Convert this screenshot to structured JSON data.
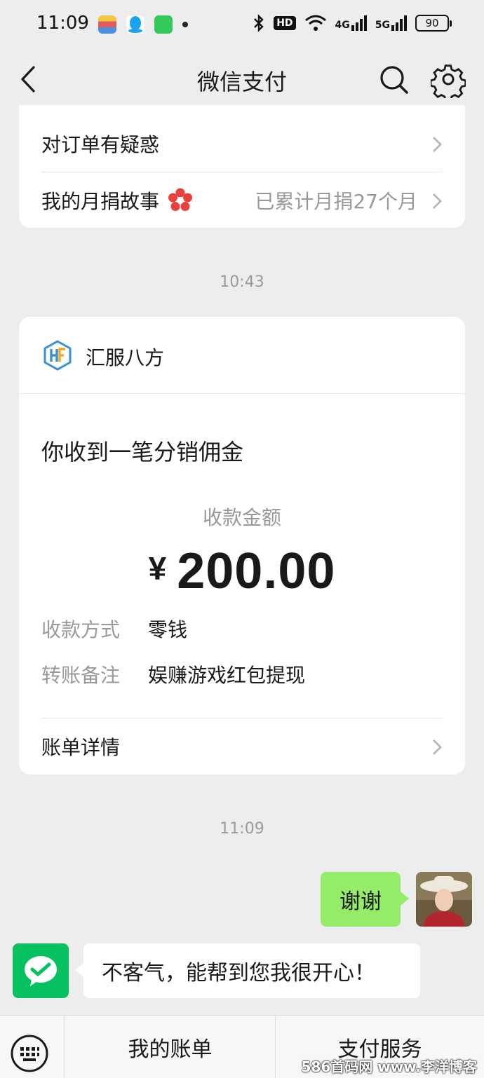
{
  "status_bar": {
    "time": "11:09",
    "hd_label": "HD",
    "net_4g": "4G",
    "net_5g": "5G",
    "battery": "90"
  },
  "nav": {
    "title": "微信支付",
    "back_icon": "chevron-left-icon",
    "search_icon": "search-icon",
    "settings_icon": "gear-icon"
  },
  "top_card": {
    "rows": [
      {
        "label": "对订单有疑惑",
        "value": ""
      },
      {
        "label": "我的月捐故事",
        "value": "已累计月捐27个月",
        "icon": "red-flower-icon"
      }
    ]
  },
  "timestamps": [
    "10:43",
    "11:09"
  ],
  "payment_card": {
    "merchant": "汇服八方",
    "title": "你收到一笔分销佣金",
    "amount_label": "收款金额",
    "currency": "¥",
    "amount": "200.00",
    "fields": [
      {
        "key": "收款方式",
        "value": "零钱"
      },
      {
        "key": "转账备注",
        "value": "娱赚游戏红包提现"
      }
    ],
    "detail_link": "账单详情"
  },
  "chat": {
    "outgoing": "谢谢",
    "incoming": "不客气，能帮到您我很开心！"
  },
  "bottom_bar": {
    "tabs": [
      "我的账单",
      "支付服务"
    ]
  },
  "watermark": "586首码网 www.李洋博客",
  "colors": {
    "background": "#ededed",
    "wechat_green": "#07c160",
    "bubble_green": "#95ec69",
    "muted_text": "#999999"
  }
}
